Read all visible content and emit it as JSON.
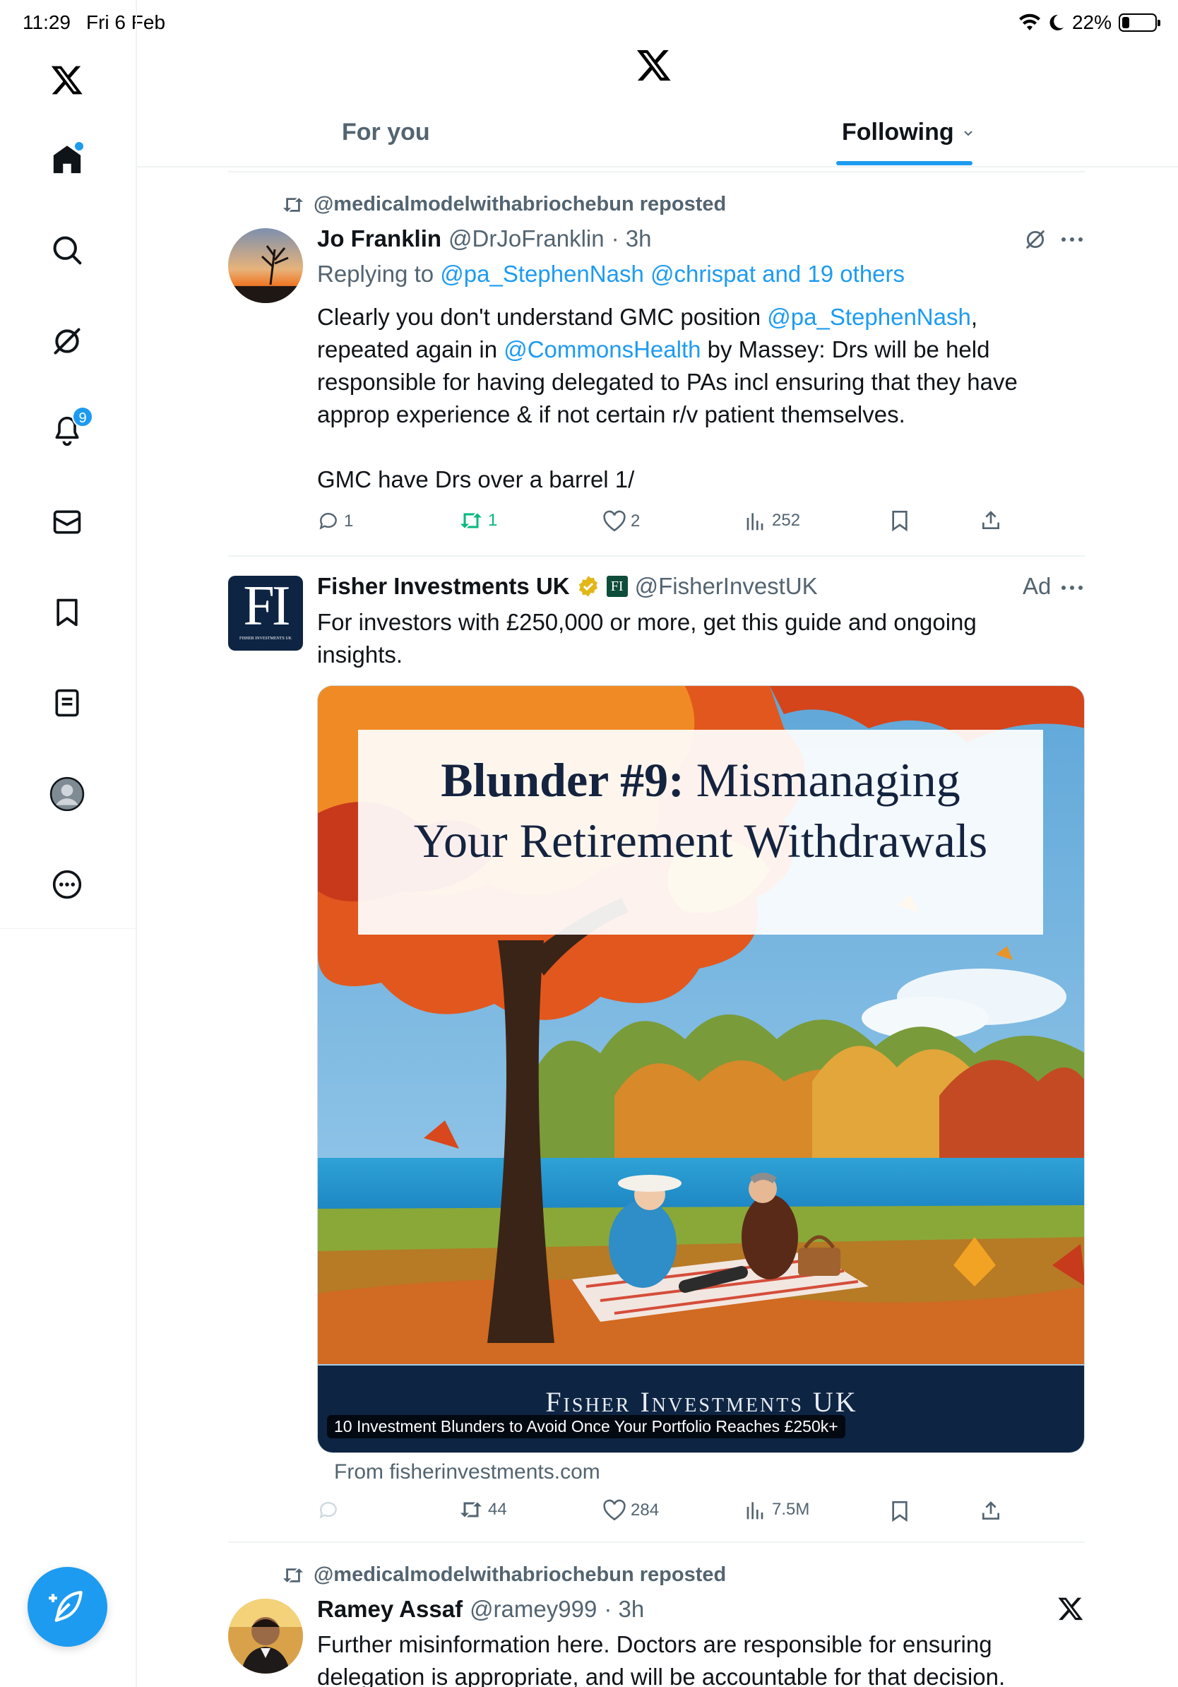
{
  "status_bar": {
    "time": "11:29",
    "date": "Fri 6 Feb",
    "battery": "22%",
    "battery_level": 0.22
  },
  "tabs": [
    {
      "label": "For you",
      "selected": false
    },
    {
      "label": "Following",
      "selected": true
    }
  ],
  "sidebar": {
    "items": [
      {
        "icon": "x-logo-icon"
      },
      {
        "icon": "home-icon",
        "active": true
      },
      {
        "icon": "search-icon"
      },
      {
        "icon": "grok-icon"
      },
      {
        "icon": "bell-icon",
        "badge": "9"
      },
      {
        "icon": "mail-icon"
      },
      {
        "icon": "bookmark-icon"
      },
      {
        "icon": "lists-icon"
      },
      {
        "icon": "profile-icon"
      },
      {
        "icon": "more-icon"
      }
    ]
  },
  "posts": [
    {
      "repost_label": "@medicalmodelwithabriochebun reposted",
      "name": "Jo Franklin",
      "handle": "@DrJoFranklin",
      "time": "· 3h",
      "replying_prefix": "Replying to",
      "replying_to": "@pa_StephenNash @chrispat and 19 others",
      "body": {
        "p1_a": "Clearly you don't understand GMC position ",
        "p1_link1": "@pa_StephenNash",
        "p1_b": ",",
        "p2_a": "repeated again in ",
        "p2_link": "@CommonsHealth",
        "p2_b": " by Massey: Drs will be held",
        "p3": "responsible for having delegated to PAs incl ensuring that they have",
        "p4": "approp experience & if not certain r/v patient themselves.",
        "p5": "GMC have Drs over a barrel 1/"
      },
      "stats": {
        "replies": "1",
        "reposts": "1",
        "likes": "2",
        "views": "252"
      }
    },
    {
      "name": "Fisher Investments UK",
      "handle": "@FisherInvestUK",
      "ad_label": "Ad",
      "body_line1": "For investors with £250,000 or more, get this guide and ongoing",
      "body_line2": "insights.",
      "avatar_text": "FI",
      "avatar_subtext": "Fisher Investments UK",
      "card": {
        "headline_1a": "Blunder #9:",
        "headline_1b": " Mismanaging",
        "headline_2": "Your Retirement Withdrawals",
        "brand": "Fisher Investments UK",
        "caption": "10 Investment Blunders to Avoid Once Your Portfolio Reaches £250k+",
        "source": "From fisherinvestments.com"
      },
      "stats": {
        "replies": "",
        "reposts": "44",
        "likes": "284",
        "views": "7.5M"
      }
    },
    {
      "repost_label": "@medicalmodelwithabriochebun reposted",
      "name": "Ramey Assaf",
      "handle": "@ramey999",
      "time": "· 3h",
      "body_line1": "Further misinformation here. Doctors are responsible for ensuring",
      "body_line2": "delegation is appropriate, and will be accountable for that decision."
    }
  ],
  "colors": {
    "accent": "#1d9bf0",
    "text": "#0f1419",
    "muted": "#536471",
    "repost_green": "#00ba7c"
  }
}
